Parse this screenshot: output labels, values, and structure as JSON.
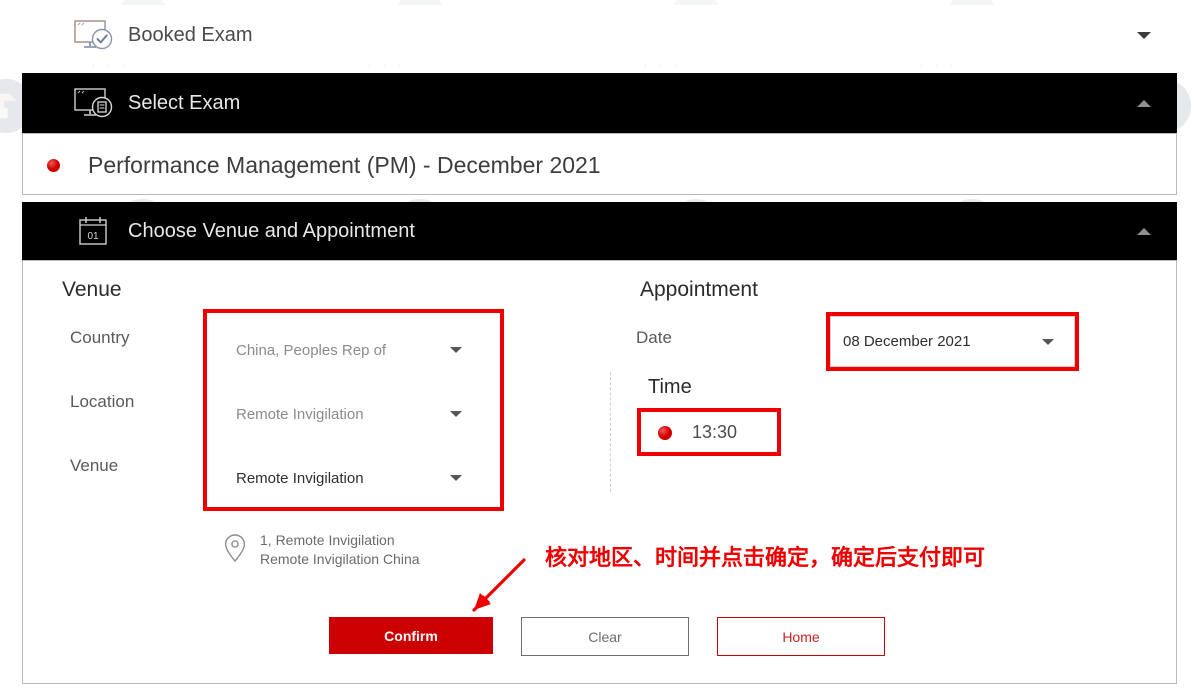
{
  "accordions": [
    {
      "id": "booked-exam",
      "title": "Booked Exam",
      "icon": "monitor-check-icon",
      "state": "collapsed",
      "chevron": "chevron-down-icon"
    },
    {
      "id": "select-exam",
      "title": "Select Exam",
      "icon": "monitor-document-icon",
      "state": "expanded",
      "chevron": "chevron-up-icon"
    },
    {
      "id": "choose-venue-appointment",
      "title": "Choose Venue and Appointment",
      "icon": "calendar-icon",
      "icon_day": "01",
      "state": "expanded",
      "chevron": "chevron-up-icon"
    }
  ],
  "selected_exam": {
    "label": "Performance Management (PM) - December 2021",
    "radio_selected": true
  },
  "venue": {
    "heading": "Venue",
    "fields": [
      {
        "label": "Country",
        "value": "China, Peoples Rep of",
        "state": "muted"
      },
      {
        "label": "Location",
        "value": "Remote Invigilation",
        "state": "muted"
      },
      {
        "label": "Venue",
        "value": "Remote Invigilation",
        "state": "dark"
      }
    ],
    "address": {
      "line1": "1, Remote Invigilation",
      "line2": "Remote Invigilation China",
      "icon": "map-pin-icon"
    }
  },
  "appointment": {
    "heading": "Appointment",
    "date_label": "Date",
    "date_value": "08 December 2021",
    "time_label": "Time",
    "time_value": "13:30",
    "time_selected": true
  },
  "buttons": {
    "confirm": "Confirm",
    "clear": "Clear",
    "home": "Home"
  },
  "annotation": {
    "note": "核对地区、时间并点击确定，确定后支付即可",
    "color": "#ee0000",
    "arrow": "red-arrow-down-left"
  },
  "colors": {
    "accent_red": "#cc0000",
    "annotation_red": "#ee0000",
    "bar_expanded": "#000000",
    "bar_collapsed": "#ffffff",
    "card_border": "#b9b9b9"
  },
  "watermark": {
    "icon": "book-logo-watermark",
    "dots": ". .  ."
  }
}
